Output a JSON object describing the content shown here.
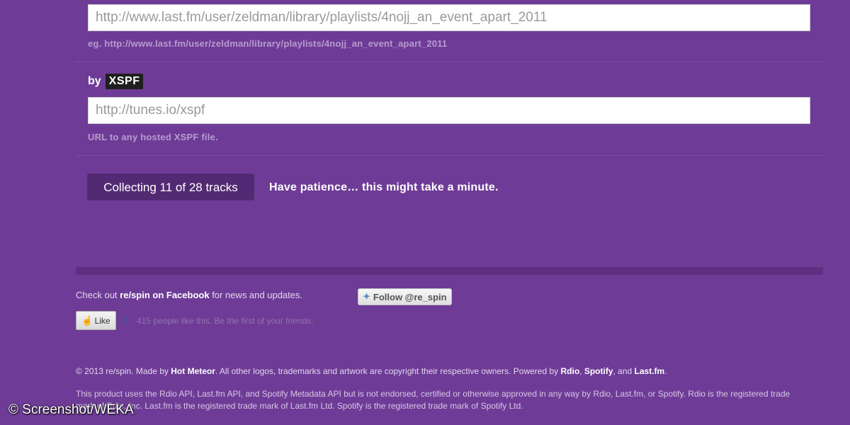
{
  "lastfm": {
    "input_value": "http://www.last.fm/user/zeldman/library/playlists/4nojj_an_event_apart_2011",
    "hint": "eg. http://www.last.fm/user/zeldman/library/playlists/4nojj_an_event_apart_2011"
  },
  "xspf": {
    "by_label": "by",
    "badge": "XSPF",
    "placeholder": "http://tunes.io/xspf",
    "hint": "URL to any hosted XSPF file."
  },
  "progress": {
    "button_label": "Collecting 11 of 28 tracks",
    "collected": 11,
    "total": 28,
    "message": "Have patience… this might take a minute."
  },
  "footer": {
    "checkout_prefix": "Check out ",
    "checkout_link": "re/spin on Facebook",
    "checkout_suffix": " for news and updates.",
    "follow_button": "Follow @re_spin",
    "like_button": "Like",
    "like_count_text": "415 people like this. Be the first of your friends.",
    "copyright_prefix": "© 2013 re/spin. Made by ",
    "copyright_author": "Hot Meteor",
    "copyright_middle": ". All other logos, trademarks and artwork are copyright their respective owners. Powered by ",
    "powered_rdio": "Rdio",
    "powered_sep1": ", ",
    "powered_spotify": "Spotify",
    "powered_sep2": ", and ",
    "powered_lastfm": "Last.fm",
    "copyright_end": ".",
    "legal": "This product uses the Rdio API, Last.fm API, and Spotify Metadata API but is not endorsed, certified or otherwise approved in any way by Rdio, Last.fm, or Spotify. Rdio is the registered trade mark of Rdio, Inc. Last.fm is the registered trade mark of Last.fm Ltd. Spotify is the registered trade mark of Spotify Ltd."
  },
  "watermark": "© Screenshot/WEKA",
  "icons": {
    "twitter": "twitter-bird-icon",
    "thumb": "thumbs-up-icon",
    "facebook": "facebook-icon"
  },
  "colors": {
    "background": "#6e3c96",
    "button": "#522a73",
    "badge": "#1f1f1f"
  }
}
